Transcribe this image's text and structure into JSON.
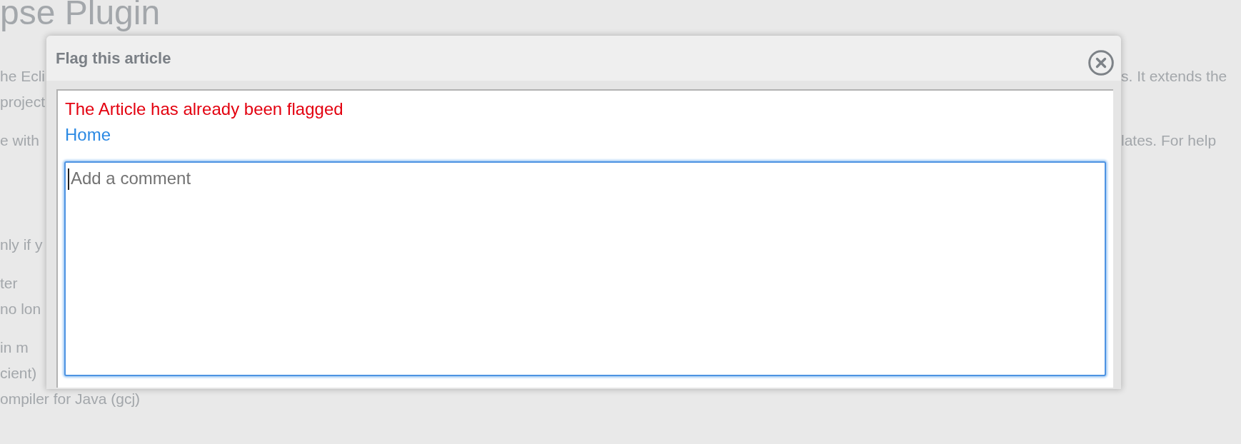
{
  "page_text": {
    "heading": "pse Plugin",
    "blocks": [
      {
        "kind": "paragraph",
        "lines": [
          {
            "left": "he Ecli",
            "right": "s. It extends the"
          },
          {
            "left": "project"
          }
        ]
      },
      {
        "kind": "paragraph",
        "lines": [
          {
            "left": "e with",
            "right": "lates. For help"
          }
        ]
      },
      {
        "kind": "section",
        "lines": [
          {
            "left": "nly if y"
          }
        ]
      },
      {
        "kind": "paragraph",
        "lines": [
          {
            "left": "ter"
          },
          {
            "left": "no lon"
          }
        ]
      },
      {
        "kind": "paragraph",
        "lines": [
          {
            "left": "in m"
          },
          {
            "left": "cient)"
          },
          {
            "left": "ompiler for Java (gcj)"
          }
        ]
      }
    ]
  },
  "dialog": {
    "title": "Flag this article",
    "message": "The Article has already been flagged",
    "link": "Home",
    "comment": {
      "placeholder": "Add a comment",
      "focused": true
    }
  }
}
